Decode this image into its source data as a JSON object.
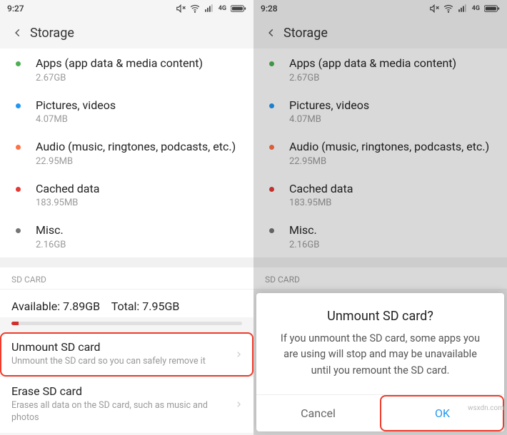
{
  "left": {
    "status": {
      "time": "9:27"
    },
    "header": {
      "title": "Storage"
    },
    "items": [
      {
        "bullet": "green",
        "title": "Apps (app data & media content)",
        "sub": "2.67GB"
      },
      {
        "bullet": "blue",
        "title": "Pictures, videos",
        "sub": "4.07MB"
      },
      {
        "bullet": "orange",
        "title": "Audio (music, ringtones, podcasts, etc.)",
        "sub": "22.95MB"
      },
      {
        "bullet": "red",
        "title": "Cached data",
        "sub": "183.95MB"
      },
      {
        "bullet": "gray",
        "title": "Misc.",
        "sub": "2.16GB"
      }
    ],
    "sd_section_label": "SD CARD",
    "sd_available_label": "Available:",
    "sd_available_value": "7.89GB",
    "sd_total_label": "Total:",
    "sd_total_value": "7.95GB",
    "actions": {
      "unmount_title": "Unmount SD card",
      "unmount_sub": "Unmount the SD card so you can safely remove it",
      "erase_title": "Erase SD card",
      "erase_sub": "Erases all data on the SD card, such as music and photos"
    }
  },
  "right": {
    "status": {
      "time": "9:28"
    },
    "header": {
      "title": "Storage"
    },
    "items": [
      {
        "bullet": "green",
        "title": "Apps (app data & media content)",
        "sub": "2.67GB"
      },
      {
        "bullet": "blue",
        "title": "Pictures, videos",
        "sub": "4.07MB"
      },
      {
        "bullet": "orange",
        "title": "Audio (music, ringtones, podcasts, etc.)",
        "sub": "22.95MB"
      },
      {
        "bullet": "red",
        "title": "Cached data",
        "sub": "183.95MB"
      },
      {
        "bullet": "gray",
        "title": "Misc.",
        "sub": "2.16GB"
      }
    ],
    "sd_section_label": "SD CARD",
    "dialog": {
      "title": "Unmount SD card?",
      "message": "If you unmount the SD card, some apps you are using will stop and may be unavailable until you remount the SD card.",
      "cancel": "Cancel",
      "ok": "OK"
    }
  },
  "watermark": "wsxdn.com"
}
